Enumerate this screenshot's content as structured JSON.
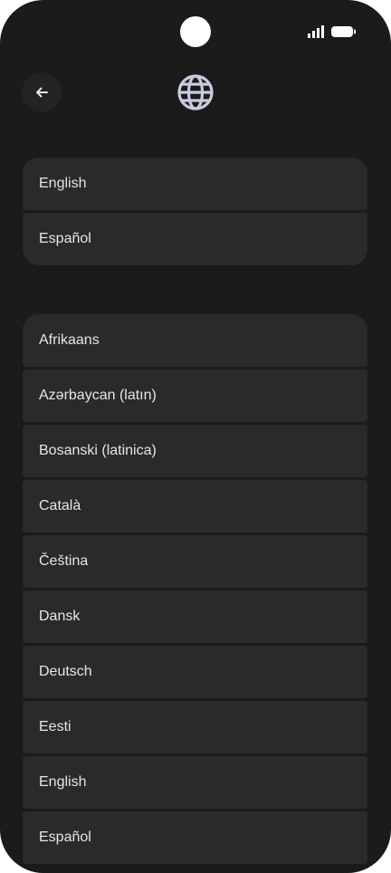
{
  "colors": {
    "background": "#1b1b1c",
    "row": "#2a2a2c",
    "text": "#e6e6e6",
    "icon": "#c9cbe0"
  },
  "header": {
    "back_icon": "arrow-left-icon",
    "title_icon": "globe-icon"
  },
  "suggested_languages": [
    {
      "label": "English"
    },
    {
      "label": "Español"
    }
  ],
  "all_languages": [
    {
      "label": "Afrikaans"
    },
    {
      "label": "Azərbaycan (latın)"
    },
    {
      "label": "Bosanski (latinica)"
    },
    {
      "label": "Català"
    },
    {
      "label": "Čeština"
    },
    {
      "label": "Dansk"
    },
    {
      "label": "Deutsch"
    },
    {
      "label": "Eesti"
    },
    {
      "label": "English"
    },
    {
      "label": "Español"
    }
  ]
}
